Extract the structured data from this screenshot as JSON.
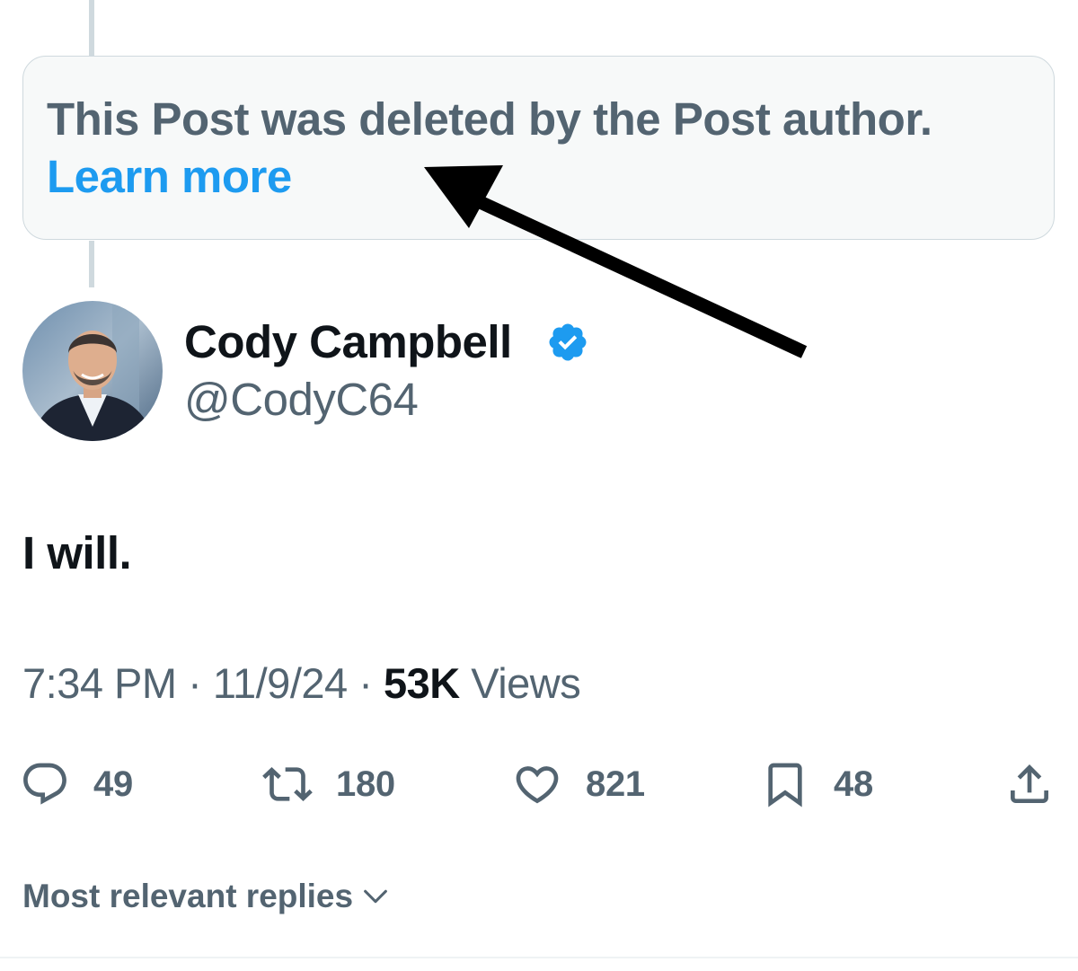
{
  "deleted_notice": {
    "message": "This Post was deleted by the Post author.",
    "link_label": "Learn more"
  },
  "author": {
    "name": "Cody Campbell",
    "handle": "@CodyC64",
    "verified": true,
    "avatar_icon": "profile-photo"
  },
  "post": {
    "text": "I will.",
    "time": "7:34 PM",
    "separator": " · ",
    "date": "11/9/24",
    "views_count": "53K",
    "views_label": " Views"
  },
  "actions": {
    "replies": "49",
    "reposts": "180",
    "likes": "821",
    "bookmarks": "48"
  },
  "replies_sort": {
    "label": "Most relevant replies"
  },
  "colors": {
    "accent": "#1d9bf0",
    "secondary_text": "#536471",
    "primary_text": "#0f1419",
    "thread_line": "#cfd9de",
    "notice_bg": "#f7f9f9"
  }
}
